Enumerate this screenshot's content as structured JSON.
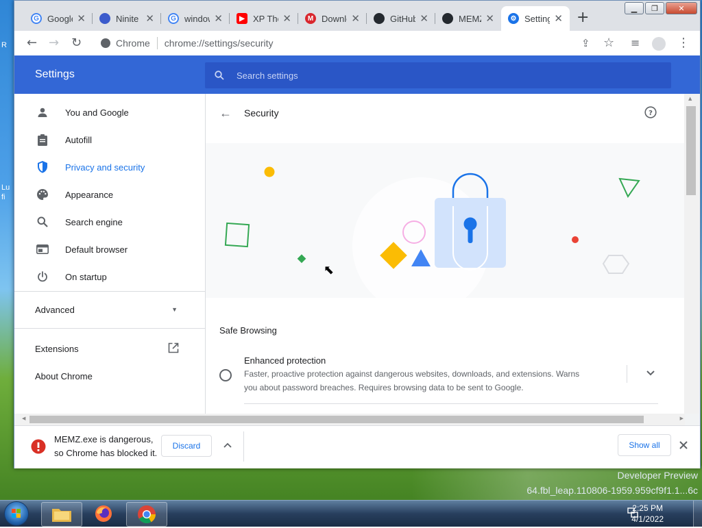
{
  "desktop": {
    "fragments": [
      "R",
      "Lu",
      "fi"
    ],
    "watermark_line1": "Developer Preview",
    "watermark_line2": "64.fbl_leap.110806-1959.959cf9f1.1...6c"
  },
  "window": {
    "tabs": [
      {
        "title": "Google",
        "favicon": "google-icon"
      },
      {
        "title": "Ninite",
        "favicon": "ninite-icon"
      },
      {
        "title": "windows",
        "favicon": "google-icon"
      },
      {
        "title": "XP The",
        "favicon": "youtube-icon"
      },
      {
        "title": "Download",
        "favicon": "mega-icon"
      },
      {
        "title": "GitHub",
        "favicon": "github-icon"
      },
      {
        "title": "MEMZ",
        "favicon": "github-icon"
      },
      {
        "title": "Settings",
        "favicon": "settings-gear-icon"
      }
    ],
    "colors": {
      "accent": "#3367d6",
      "search": "#2a56c6",
      "selected": "#1a73e8",
      "danger": "#d93025"
    }
  },
  "omnibox": {
    "site_label": "Chrome",
    "url": "chrome://settings/security"
  },
  "settings": {
    "title": "Settings",
    "search_placeholder": "Search settings",
    "nav": [
      {
        "label": "You and Google",
        "icon": "person-icon"
      },
      {
        "label": "Autofill",
        "icon": "clipboard-icon"
      },
      {
        "label": "Privacy and security",
        "icon": "shield-icon"
      },
      {
        "label": "Appearance",
        "icon": "palette-icon"
      },
      {
        "label": "Search engine",
        "icon": "search-icon"
      },
      {
        "label": "Default browser",
        "icon": "browser-icon"
      },
      {
        "label": "On startup",
        "icon": "power-icon"
      }
    ],
    "advanced_label": "Advanced",
    "extensions_label": "Extensions",
    "about_label": "About Chrome"
  },
  "main": {
    "page_title": "Security",
    "section_heading": "Safe Browsing",
    "option_title": "Enhanced protection",
    "option_desc_1": "Faster, proactive protection against dangerous websites, downloads, and extensions. Warns",
    "option_desc_2": "you about password breaches. Requires browsing data to be sent to Google."
  },
  "download": {
    "line1": "MEMZ.exe is dangerous,",
    "line2": "so Chrome has blocked it.",
    "discard_label": "Discard",
    "show_all_label": "Show all"
  },
  "clock": {
    "time": "2:25 PM",
    "date": "4/1/2022"
  }
}
